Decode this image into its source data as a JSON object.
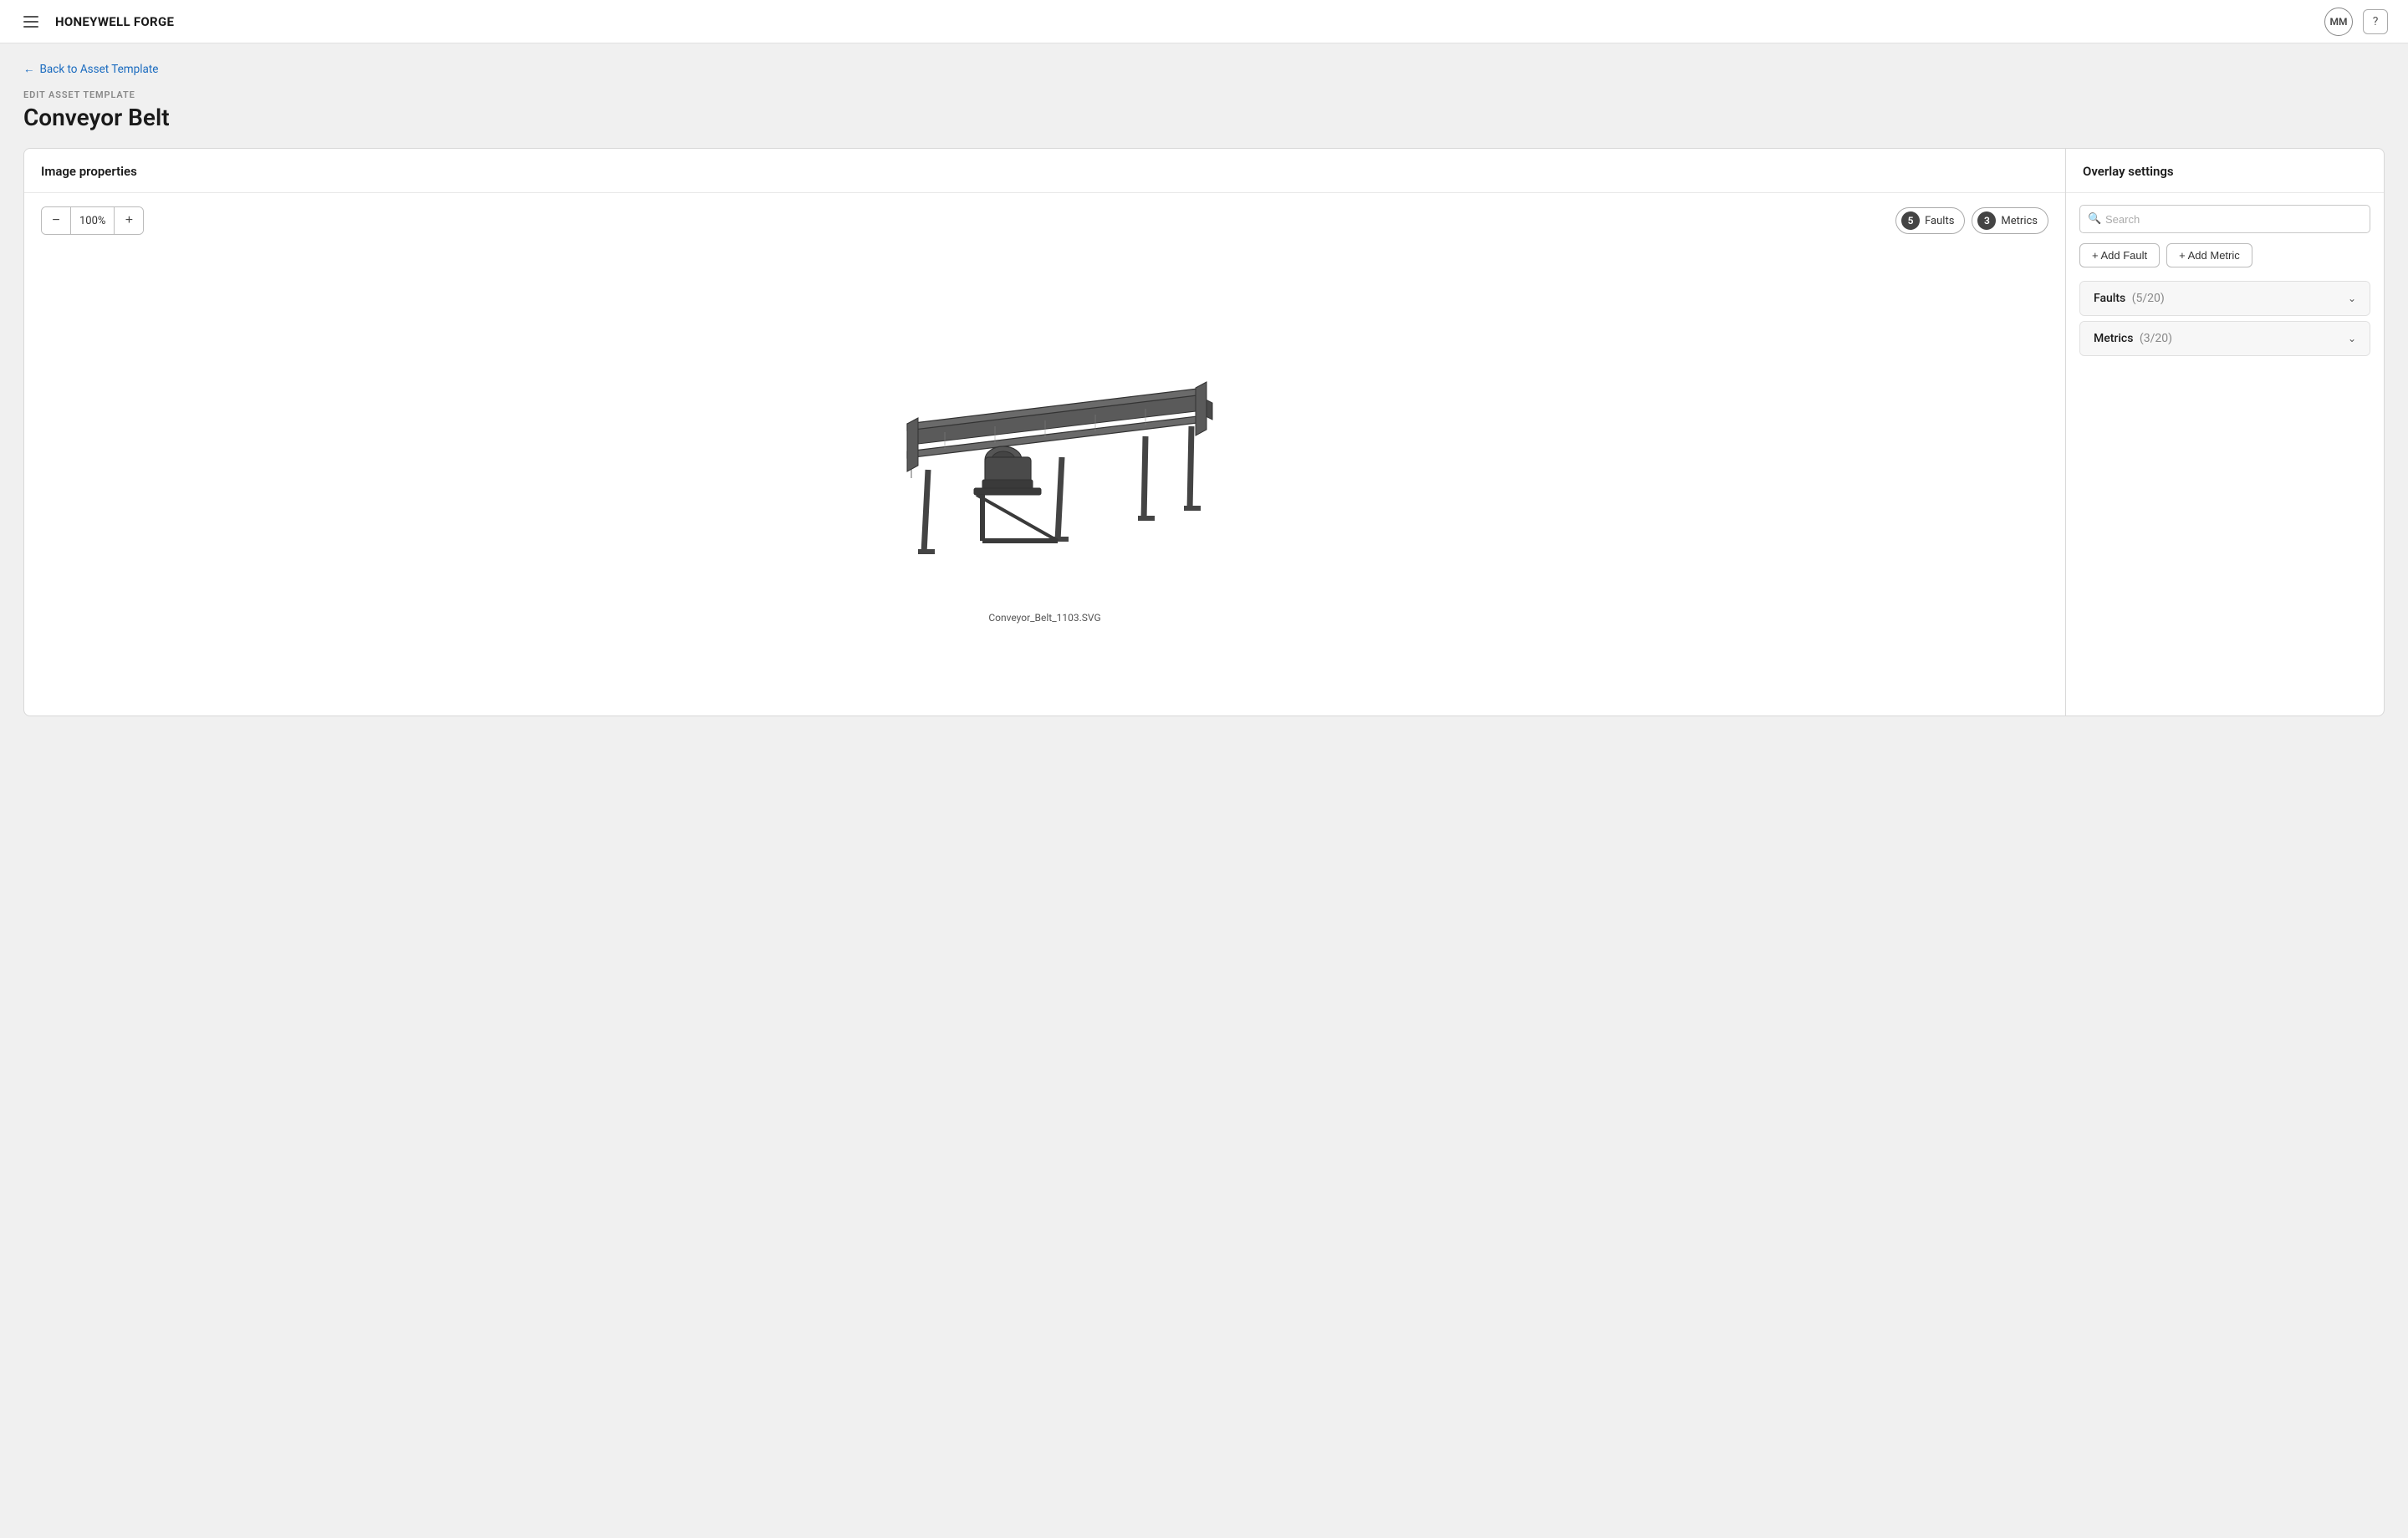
{
  "topnav": {
    "brand": "HONEYWELL FORGE",
    "avatar_initials": "MM",
    "help_icon": "?"
  },
  "back_link": {
    "label": "Back to Asset Template",
    "arrow": "←"
  },
  "page_header": {
    "subtitle": "EDIT ASSET TEMPLATE",
    "title": "Conveyor Belt"
  },
  "left_panel": {
    "header": "Image properties",
    "zoom": {
      "minus": "−",
      "value": "100%",
      "plus": "+"
    },
    "badges": [
      {
        "count": "5",
        "label": "Faults"
      },
      {
        "count": "3",
        "label": "Metrics"
      }
    ],
    "image_filename": "Conveyor_Belt_1103.SVG"
  },
  "right_panel": {
    "header": "Overlay settings",
    "search_placeholder": "Search",
    "add_fault_label": "+ Add Fault",
    "add_metric_label": "+ Add Metric",
    "accordion_items": [
      {
        "title": "Faults",
        "count": "(5/20)"
      },
      {
        "title": "Metrics",
        "count": "(3/20)"
      }
    ]
  }
}
